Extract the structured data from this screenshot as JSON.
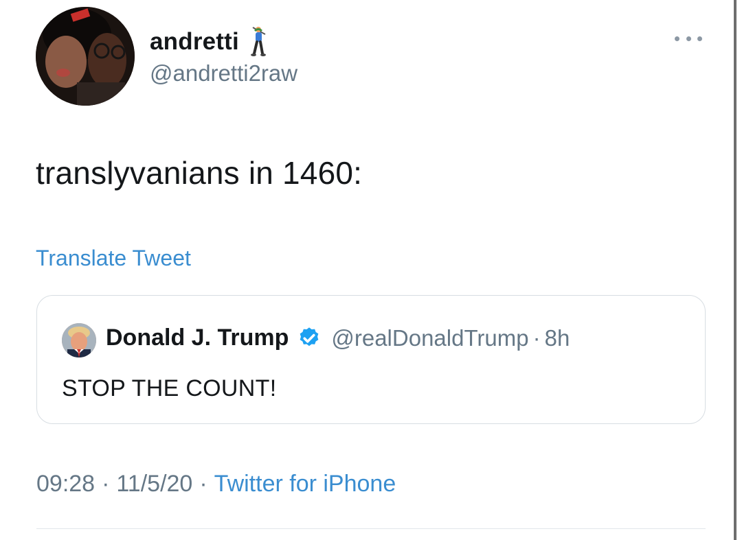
{
  "author": {
    "display_name": "andretti",
    "name_emoji": "golfer-emoji",
    "handle": "@andretti2raw",
    "avatar": "profile-photo"
  },
  "tweet": {
    "text": "translyvanians in 1460:",
    "translate_label": "Translate Tweet"
  },
  "quoted_tweet": {
    "display_name": "Donald J. Trump",
    "verified": true,
    "handle": "@realDonaldTrump",
    "separator": "·",
    "time": "8h",
    "text": "STOP THE COUNT!"
  },
  "meta": {
    "time": "09:28",
    "date": "11/5/20",
    "separator": "·",
    "source": "Twitter for iPhone"
  },
  "colors": {
    "link": "#3a8dd0",
    "secondary_text": "#657786",
    "primary_text": "#14171a",
    "verified": "#1da1f2",
    "border": "#d7dde2"
  }
}
